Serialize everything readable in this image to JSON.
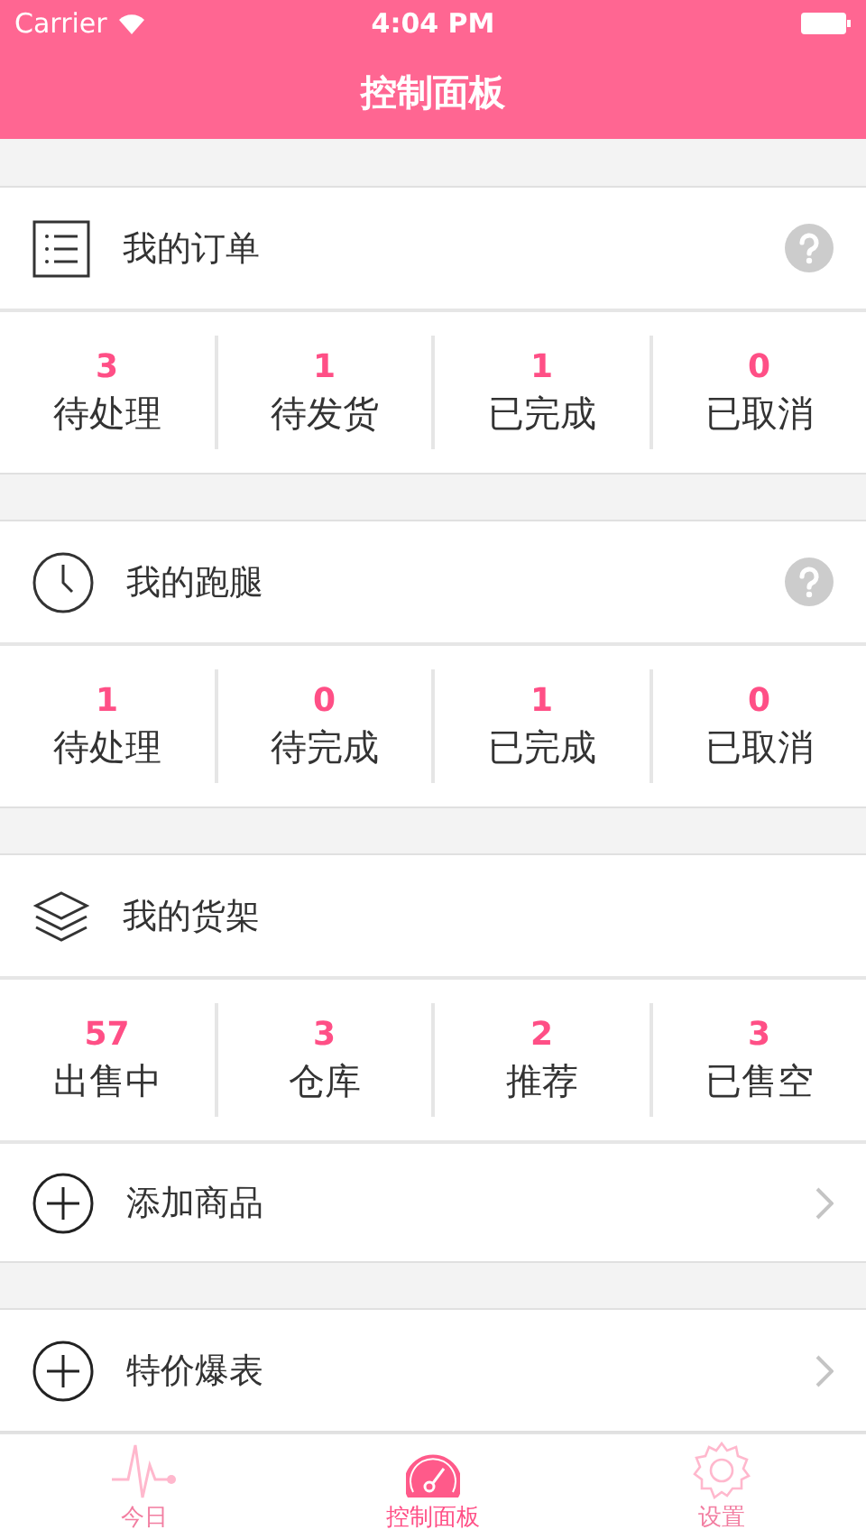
{
  "status_bar": {
    "carrier": "Carrier",
    "time": "4:04 PM"
  },
  "nav": {
    "title": "控制面板"
  },
  "groups": [
    {
      "items": [
        {
          "kind": "header",
          "title": "我的订单",
          "help": true
        },
        {
          "kind": "stats",
          "stats": [
            {
              "value": "3",
              "label": "待处理"
            },
            {
              "value": "1",
              "label": "待发货"
            },
            {
              "value": "1",
              "label": "已完成"
            },
            {
              "value": "0",
              "label": "已取消"
            }
          ]
        }
      ]
    },
    {
      "items": [
        {
          "kind": "header",
          "title": "我的跑腿",
          "help": true
        },
        {
          "kind": "stats",
          "stats": [
            {
              "value": "1",
              "label": "待处理"
            },
            {
              "value": "0",
              "label": "待完成"
            },
            {
              "value": "1",
              "label": "已完成"
            },
            {
              "value": "0",
              "label": "已取消"
            }
          ]
        }
      ]
    },
    {
      "items": [
        {
          "kind": "header",
          "title": "我的货架",
          "help": false
        },
        {
          "kind": "stats",
          "stats": [
            {
              "value": "57",
              "label": "出售中"
            },
            {
              "value": "3",
              "label": "仓库"
            },
            {
              "value": "2",
              "label": "推荐"
            },
            {
              "value": "3",
              "label": "已售空"
            }
          ]
        },
        {
          "kind": "action",
          "title": "添加商品"
        }
      ]
    },
    {
      "items": [
        {
          "kind": "action",
          "title": "特价爆表"
        }
      ]
    }
  ],
  "tabs": [
    {
      "label": "今日",
      "selected": false
    },
    {
      "label": "控制面板",
      "selected": true
    },
    {
      "label": "设置",
      "selected": false
    }
  ]
}
